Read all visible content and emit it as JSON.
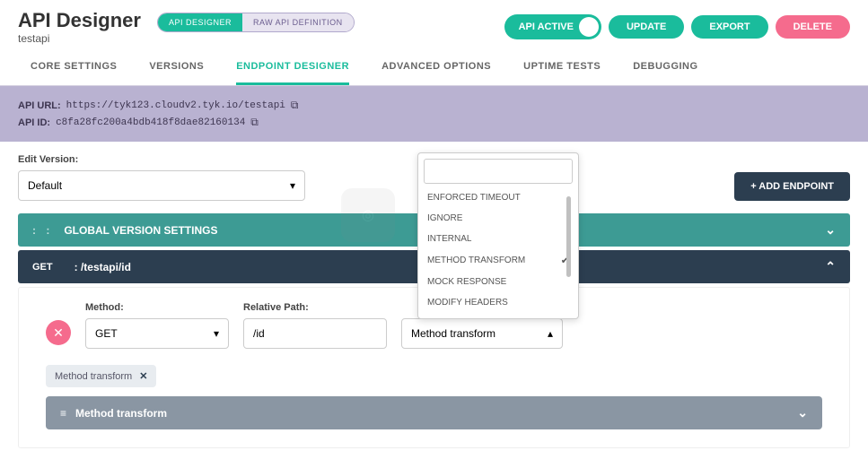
{
  "header": {
    "title": "API Designer",
    "subtitle": "testapi",
    "pills": {
      "designer": "API DESIGNER",
      "raw": "RAW API DEFINITION"
    },
    "buttons": {
      "active": "API ACTIVE",
      "update": "UPDATE",
      "export": "EXPORT",
      "delete": "DELETE"
    }
  },
  "tabs": {
    "core": "CORE SETTINGS",
    "versions": "VERSIONS",
    "endpoint": "ENDPOINT DESIGNER",
    "advanced": "ADVANCED OPTIONS",
    "uptime": "UPTIME TESTS",
    "debugging": "DEBUGGING"
  },
  "info": {
    "url_label": "API URL:",
    "url_value": "https://tyk123.cloudv2.tyk.io/testapi",
    "id_label": "API ID:",
    "id_value": "c8fa28fc200a4bdb418f8dae82160134"
  },
  "edit": {
    "version_label": "Edit Version:",
    "version_value": "Default",
    "add_endpoint": "+ ADD ENDPOINT"
  },
  "bars": {
    "global": "GLOBAL VERSION SETTINGS",
    "endpoint_method": "GET",
    "endpoint_path": ": /testapi/id",
    "method_transform_title": "Method transform"
  },
  "form": {
    "method_label": "Method:",
    "method_value": "GET",
    "path_label": "Relative Path:",
    "path_value": "/id",
    "plugin_value": "Method transform",
    "tag_label": "Method transform"
  },
  "dropdown": {
    "items": [
      {
        "label": "ENFORCED TIMEOUT",
        "checked": false
      },
      {
        "label": "IGNORE",
        "checked": false
      },
      {
        "label": "INTERNAL",
        "checked": false
      },
      {
        "label": "METHOD TRANSFORM",
        "checked": true
      },
      {
        "label": "MOCK RESPONSE",
        "checked": false
      },
      {
        "label": "MODIFY HEADERS",
        "checked": false
      }
    ]
  }
}
